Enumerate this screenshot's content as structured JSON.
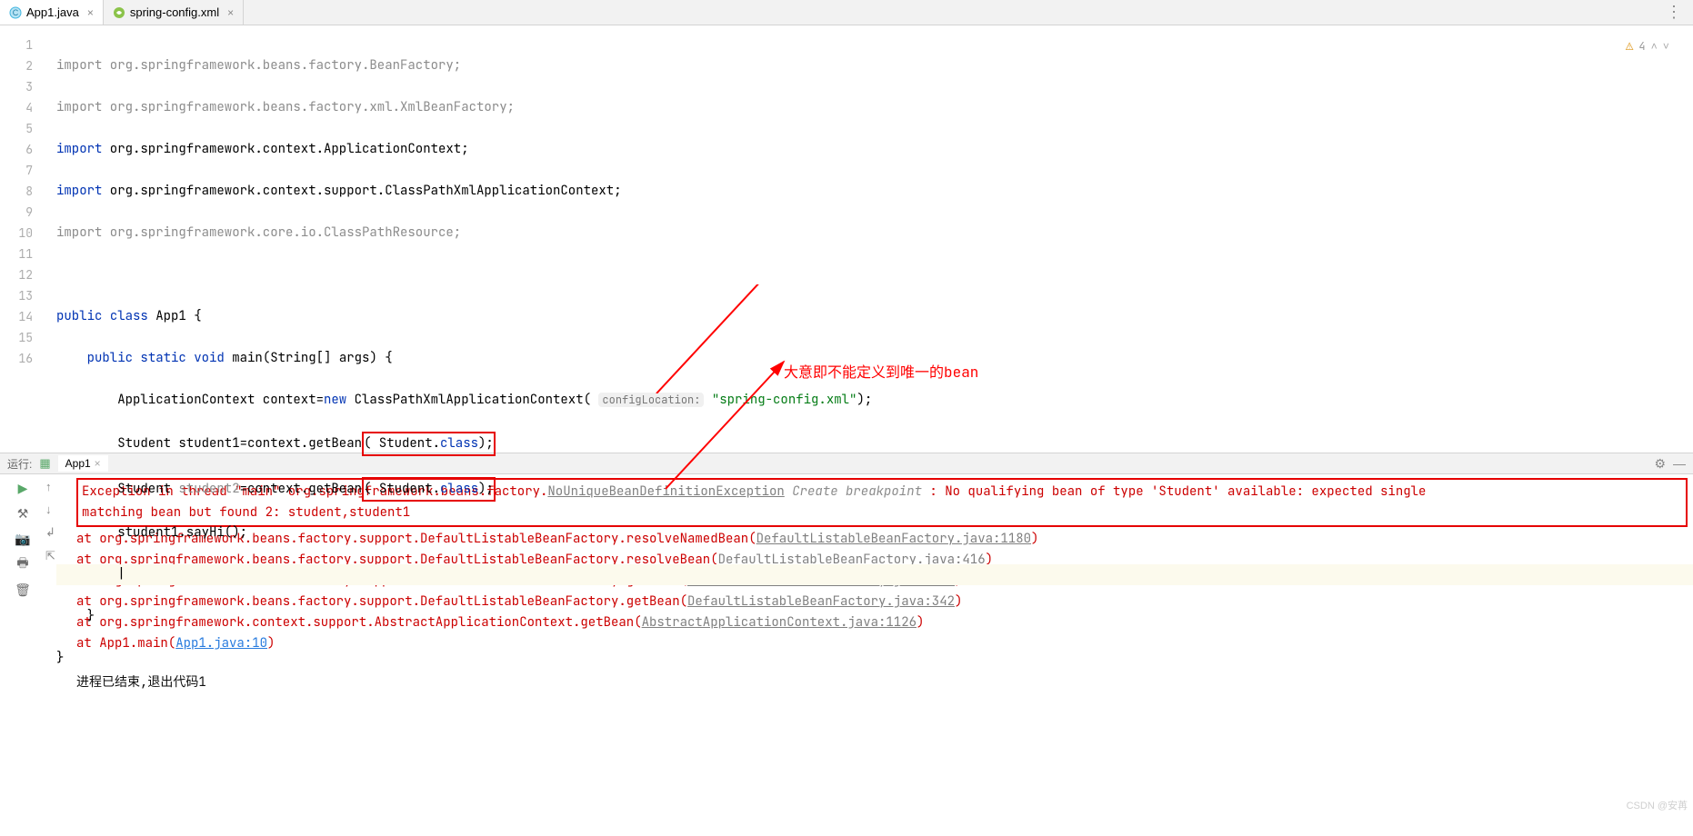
{
  "tabs": [
    {
      "label": "App1.java",
      "icon_color": "#40b6e0"
    },
    {
      "label": "spring-config.xml",
      "icon_color": "#8bc34a"
    }
  ],
  "warning_count": "4",
  "gutter_lines": [
    "1",
    "2",
    "3",
    "4",
    "5",
    "6",
    "7",
    "8",
    "9",
    "10",
    "11",
    "12",
    "13",
    "14",
    "15",
    "16"
  ],
  "code": {
    "l1": "import org.springframework.beans.factory.BeanFactory;",
    "l2": "import org.springframework.beans.factory.xml.XmlBeanFactory;",
    "l3_pre": "import",
    "l3_b": " org.springframework.context.ApplicationContext;",
    "l4_pre": "import",
    "l4_b": " org.springframework.context.support.ClassPathXmlApplicationContext;",
    "l5": "import org.springframework.core.io.ClassPathResource;",
    "l7_pub": "public ",
    "l7_cls": "class ",
    "l7_name": "App1 {",
    "l8_pub": "public ",
    "l8_static": "static ",
    "l8_void": "void ",
    "l8_main": "main",
    "l8_args": "(String[] args) {",
    "l9_a": "        ApplicationContext context=",
    "l9_new": "new ",
    "l9_b": "ClassPathXmlApplicationContext( ",
    "l9_hint": "configLocation:",
    "l9_str": " \"spring-config.xml\"",
    "l9_end": ");",
    "l10_a": "        Student student1=context.getBean",
    "l10_box_a": "( Student.",
    "l10_box_kw": "class",
    "l10_box_b": ");",
    "l11_a": "        Student ",
    "l11_gray": "student2",
    "l11_b": "=context.getBean",
    "l11_box_a": "( Student.",
    "l11_box_kw": "class",
    "l11_box_b": ");",
    "l12": "        student1.sayHi();",
    "l14": "    }",
    "l15": "}"
  },
  "annotation": "大意即不能定义到唯一的bean",
  "run_panel_label": "运行:",
  "run_tab_label": "App1",
  "console": {
    "exc_a": "Exception in thread \"main\" org.springframework.beans.factory.",
    "exc_link": "NoUniqueBeanDefinitionException",
    "bp": " Create breakpoint ",
    "exc_b": ": No qualifying bean of type 'Student' available: expected single",
    "exc_c": "  matching bean but found 2: student,student1",
    "at1": "    at org.springframework.beans.factory.support.DefaultListableBeanFactory.resolveNamedBean(",
    "at1_l": "DefaultListableBeanFactory.java:1180",
    "at1_e": ")",
    "at2": "    at org.springframework.beans.factory.support.DefaultListableBeanFactory.resolveBean(",
    "at2_l": "DefaultListableBeanFactory.java:416",
    "at2_e": ")",
    "at3": "    at org.springframework.beans.factory.support.DefaultListableBeanFactory.getBean(",
    "at3_l": "DefaultListableBeanFactory.java:349",
    "at3_e": ")",
    "at4": "    at org.springframework.beans.factory.support.DefaultListableBeanFactory.getBean(",
    "at4_l": "DefaultListableBeanFactory.java:342",
    "at4_e": ")",
    "at5": "    at org.springframework.context.support.AbstractApplicationContext.getBean(",
    "at5_l": "AbstractApplicationContext.java:1126",
    "at5_e": ")",
    "at6": "    at App1.main(",
    "at6_l": "App1.java:10",
    "at6_e": ")",
    "exit": "进程已结束,退出代码1"
  },
  "watermark": "CSDN @安苒"
}
